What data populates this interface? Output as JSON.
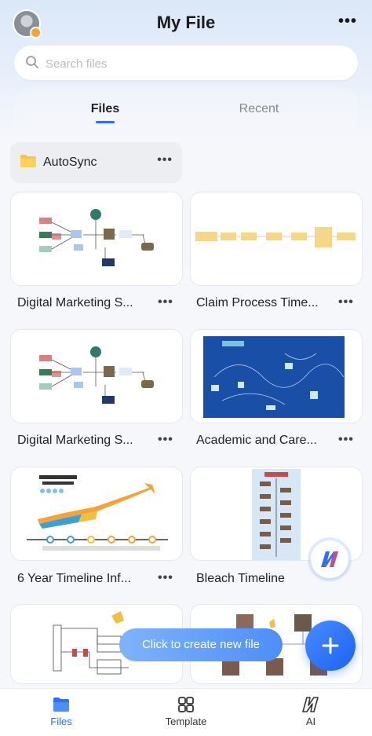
{
  "header": {
    "title": "My File",
    "more_label": "•••"
  },
  "search": {
    "placeholder": "Search files"
  },
  "tabs": [
    {
      "label": "Files",
      "active": true
    },
    {
      "label": "Recent",
      "active": false
    }
  ],
  "autosync": {
    "label": "AutoSync",
    "more_label": "•••"
  },
  "files": [
    {
      "title": "Digital Marketing S...",
      "more_label": "•••",
      "thumb": "flowchart"
    },
    {
      "title": "Claim Process Time...",
      "more_label": "•••",
      "thumb": "process-timeline"
    },
    {
      "title": "Digital Marketing S...",
      "more_label": "•••",
      "thumb": "flowchart"
    },
    {
      "title": "Academic and Care...",
      "more_label": "•••",
      "thumb": "blue-mindmap"
    },
    {
      "title": "6 Year Timeline Inf...",
      "more_label": "•••",
      "thumb": "timeline-infographic"
    },
    {
      "title": "Bleach Timeline",
      "more_label": "•••",
      "thumb": "vertical-timeline"
    }
  ],
  "toast": {
    "text": "Click to create new file"
  },
  "bottom_nav": [
    {
      "label": "Files",
      "icon": "folder-icon",
      "active": true
    },
    {
      "label": "Template",
      "icon": "grid-icon",
      "active": false
    },
    {
      "label": "AI",
      "icon": "ai-logo-icon",
      "active": false
    }
  ],
  "colors": {
    "accent": "#2f6ef5",
    "folder": "#f7c548",
    "canvas_blue": "#1a4fa8"
  }
}
